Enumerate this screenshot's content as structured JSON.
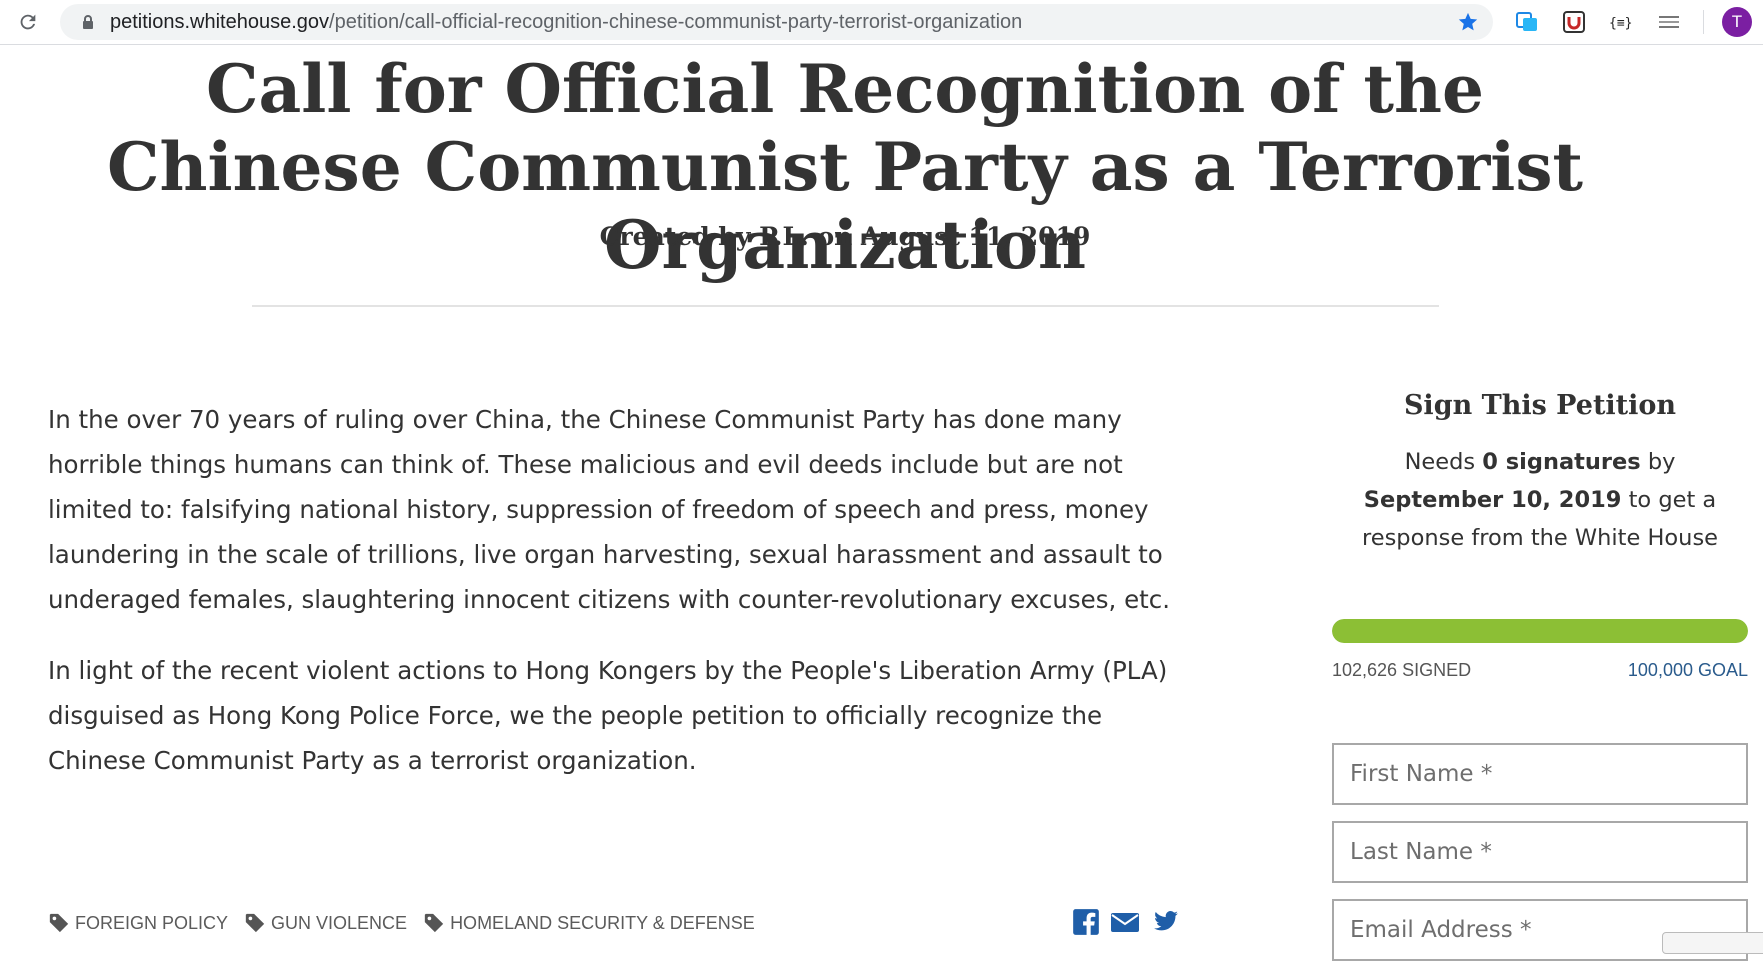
{
  "browser": {
    "url_host": "petitions.whitehouse.gov",
    "url_path": "/petition/call-official-recognition-chinese-communist-party-terrorist-organization",
    "profile_initial": "T",
    "icons": [
      "reload-icon",
      "lock-icon",
      "bookmark-star-icon",
      "extension-icon",
      "extension-icon",
      "extension-icon",
      "extension-icon"
    ]
  },
  "petition": {
    "title": "Call for Official Recognition of the Chinese Communist Party as a Terrorist Organization",
    "byline": "Created by P.L. on August 11, 2019",
    "paragraphs": [
      "In the over 70 years of ruling over China, the Chinese Communist Party has done many horrible things humans can think of. These malicious and evil deeds include but are not limited to: falsifying national history, suppression of freedom of speech and press, money laundering in the scale of trillions, live organ harvesting, sexual harassment and assault to underaged females, slaughtering innocent citizens with counter-revolutionary excuses, etc.",
      "In light of the recent violent actions to Hong Kongers by the People's Liberation Army (PLA) disguised as Hong Kong Police Force, we the people petition to officially recognize the Chinese Communist Party as a terrorist organization."
    ],
    "tags": [
      "FOREIGN POLICY",
      "GUN VIOLENCE",
      "HOMELAND SECURITY & DEFENSE"
    ]
  },
  "sidebar": {
    "title": "Sign This Petition",
    "needs_prefix": "Needs ",
    "needs_count": "0 signatures",
    "needs_mid": " by ",
    "needs_date": "September 10, 2019",
    "needs_suffix": " to get a response from the White House",
    "progress_fraction": 1.0,
    "progress_color": "#8cbf35",
    "signed": "102,626 SIGNED",
    "goal": "100,000 GOAL",
    "first_name_placeholder": "First Name *",
    "last_name_placeholder": "Last Name *",
    "email_placeholder": "Email Address *"
  }
}
